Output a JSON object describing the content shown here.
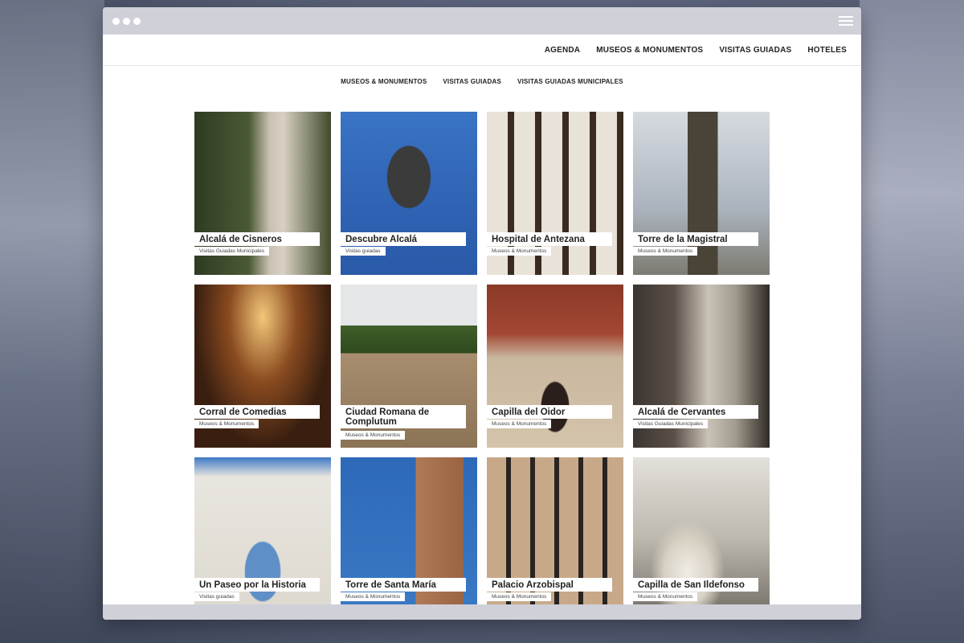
{
  "window": {
    "top_nav": [
      "AGENDA",
      "MUSEOS & MONUMENTOS",
      "VISITAS GUIADAS",
      "HOTELES"
    ],
    "sub_nav": [
      "MUSEOS & MONUMENTOS",
      "VISITAS GUIADAS",
      "VISITAS GUIADAS MUNICIPALES"
    ]
  },
  "cards": [
    {
      "title": "Alcalá de Cisneros",
      "category": "Visitas Guiadas Municipales"
    },
    {
      "title": "Descubre Alcalá",
      "category": "Visitas guiadas"
    },
    {
      "title": "Hospital de Antezana",
      "category": "Museos & Monumentos"
    },
    {
      "title": "Torre de la Magistral",
      "category": "Museos & Monumentos"
    },
    {
      "title": "Corral de Comedias",
      "category": "Museos & Monumentos"
    },
    {
      "title": "Ciudad Romana de Complutum",
      "category": "Museos & Monumentos"
    },
    {
      "title": "Capilla del Oidor",
      "category": "Museos & Monumentos"
    },
    {
      "title": "Alcalá de Cervantes",
      "category": "Visitas Guiadas Municipales"
    },
    {
      "title": "Un Paseo por la Historia",
      "category": "Visitas guiadas"
    },
    {
      "title": "Torre de Santa María",
      "category": "Museos & Monumentos"
    },
    {
      "title": "Palacio Arzobispal",
      "category": "Museos & Monumentos"
    },
    {
      "title": "Capilla de San Ildefonso",
      "category": "Museos & Monumentos"
    }
  ],
  "colors": {
    "titlebar": "#cfd0d8",
    "text": "#222222"
  }
}
